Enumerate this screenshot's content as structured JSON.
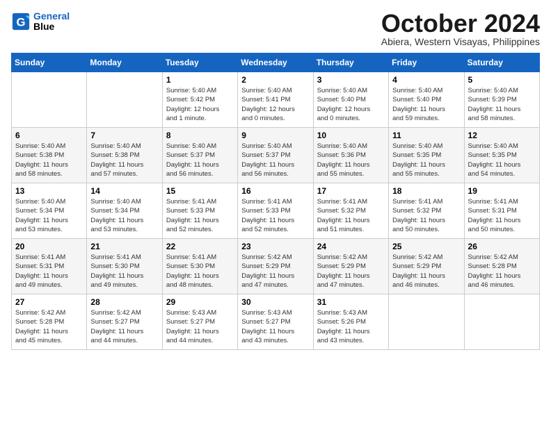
{
  "header": {
    "logo_line1": "General",
    "logo_line2": "Blue",
    "month_title": "October 2024",
    "subtitle": "Abiera, Western Visayas, Philippines"
  },
  "weekdays": [
    "Sunday",
    "Monday",
    "Tuesday",
    "Wednesday",
    "Thursday",
    "Friday",
    "Saturday"
  ],
  "weeks": [
    [
      {
        "num": "",
        "info": ""
      },
      {
        "num": "",
        "info": ""
      },
      {
        "num": "1",
        "info": "Sunrise: 5:40 AM\nSunset: 5:42 PM\nDaylight: 12 hours\nand 1 minute."
      },
      {
        "num": "2",
        "info": "Sunrise: 5:40 AM\nSunset: 5:41 PM\nDaylight: 12 hours\nand 0 minutes."
      },
      {
        "num": "3",
        "info": "Sunrise: 5:40 AM\nSunset: 5:40 PM\nDaylight: 12 hours\nand 0 minutes."
      },
      {
        "num": "4",
        "info": "Sunrise: 5:40 AM\nSunset: 5:40 PM\nDaylight: 11 hours\nand 59 minutes."
      },
      {
        "num": "5",
        "info": "Sunrise: 5:40 AM\nSunset: 5:39 PM\nDaylight: 11 hours\nand 58 minutes."
      }
    ],
    [
      {
        "num": "6",
        "info": "Sunrise: 5:40 AM\nSunset: 5:38 PM\nDaylight: 11 hours\nand 58 minutes."
      },
      {
        "num": "7",
        "info": "Sunrise: 5:40 AM\nSunset: 5:38 PM\nDaylight: 11 hours\nand 57 minutes."
      },
      {
        "num": "8",
        "info": "Sunrise: 5:40 AM\nSunset: 5:37 PM\nDaylight: 11 hours\nand 56 minutes."
      },
      {
        "num": "9",
        "info": "Sunrise: 5:40 AM\nSunset: 5:37 PM\nDaylight: 11 hours\nand 56 minutes."
      },
      {
        "num": "10",
        "info": "Sunrise: 5:40 AM\nSunset: 5:36 PM\nDaylight: 11 hours\nand 55 minutes."
      },
      {
        "num": "11",
        "info": "Sunrise: 5:40 AM\nSunset: 5:35 PM\nDaylight: 11 hours\nand 55 minutes."
      },
      {
        "num": "12",
        "info": "Sunrise: 5:40 AM\nSunset: 5:35 PM\nDaylight: 11 hours\nand 54 minutes."
      }
    ],
    [
      {
        "num": "13",
        "info": "Sunrise: 5:40 AM\nSunset: 5:34 PM\nDaylight: 11 hours\nand 53 minutes."
      },
      {
        "num": "14",
        "info": "Sunrise: 5:40 AM\nSunset: 5:34 PM\nDaylight: 11 hours\nand 53 minutes."
      },
      {
        "num": "15",
        "info": "Sunrise: 5:41 AM\nSunset: 5:33 PM\nDaylight: 11 hours\nand 52 minutes."
      },
      {
        "num": "16",
        "info": "Sunrise: 5:41 AM\nSunset: 5:33 PM\nDaylight: 11 hours\nand 52 minutes."
      },
      {
        "num": "17",
        "info": "Sunrise: 5:41 AM\nSunset: 5:32 PM\nDaylight: 11 hours\nand 51 minutes."
      },
      {
        "num": "18",
        "info": "Sunrise: 5:41 AM\nSunset: 5:32 PM\nDaylight: 11 hours\nand 50 minutes."
      },
      {
        "num": "19",
        "info": "Sunrise: 5:41 AM\nSunset: 5:31 PM\nDaylight: 11 hours\nand 50 minutes."
      }
    ],
    [
      {
        "num": "20",
        "info": "Sunrise: 5:41 AM\nSunset: 5:31 PM\nDaylight: 11 hours\nand 49 minutes."
      },
      {
        "num": "21",
        "info": "Sunrise: 5:41 AM\nSunset: 5:30 PM\nDaylight: 11 hours\nand 49 minutes."
      },
      {
        "num": "22",
        "info": "Sunrise: 5:41 AM\nSunset: 5:30 PM\nDaylight: 11 hours\nand 48 minutes."
      },
      {
        "num": "23",
        "info": "Sunrise: 5:42 AM\nSunset: 5:29 PM\nDaylight: 11 hours\nand 47 minutes."
      },
      {
        "num": "24",
        "info": "Sunrise: 5:42 AM\nSunset: 5:29 PM\nDaylight: 11 hours\nand 47 minutes."
      },
      {
        "num": "25",
        "info": "Sunrise: 5:42 AM\nSunset: 5:29 PM\nDaylight: 11 hours\nand 46 minutes."
      },
      {
        "num": "26",
        "info": "Sunrise: 5:42 AM\nSunset: 5:28 PM\nDaylight: 11 hours\nand 46 minutes."
      }
    ],
    [
      {
        "num": "27",
        "info": "Sunrise: 5:42 AM\nSunset: 5:28 PM\nDaylight: 11 hours\nand 45 minutes."
      },
      {
        "num": "28",
        "info": "Sunrise: 5:42 AM\nSunset: 5:27 PM\nDaylight: 11 hours\nand 44 minutes."
      },
      {
        "num": "29",
        "info": "Sunrise: 5:43 AM\nSunset: 5:27 PM\nDaylight: 11 hours\nand 44 minutes."
      },
      {
        "num": "30",
        "info": "Sunrise: 5:43 AM\nSunset: 5:27 PM\nDaylight: 11 hours\nand 43 minutes."
      },
      {
        "num": "31",
        "info": "Sunrise: 5:43 AM\nSunset: 5:26 PM\nDaylight: 11 hours\nand 43 minutes."
      },
      {
        "num": "",
        "info": ""
      },
      {
        "num": "",
        "info": ""
      }
    ]
  ]
}
